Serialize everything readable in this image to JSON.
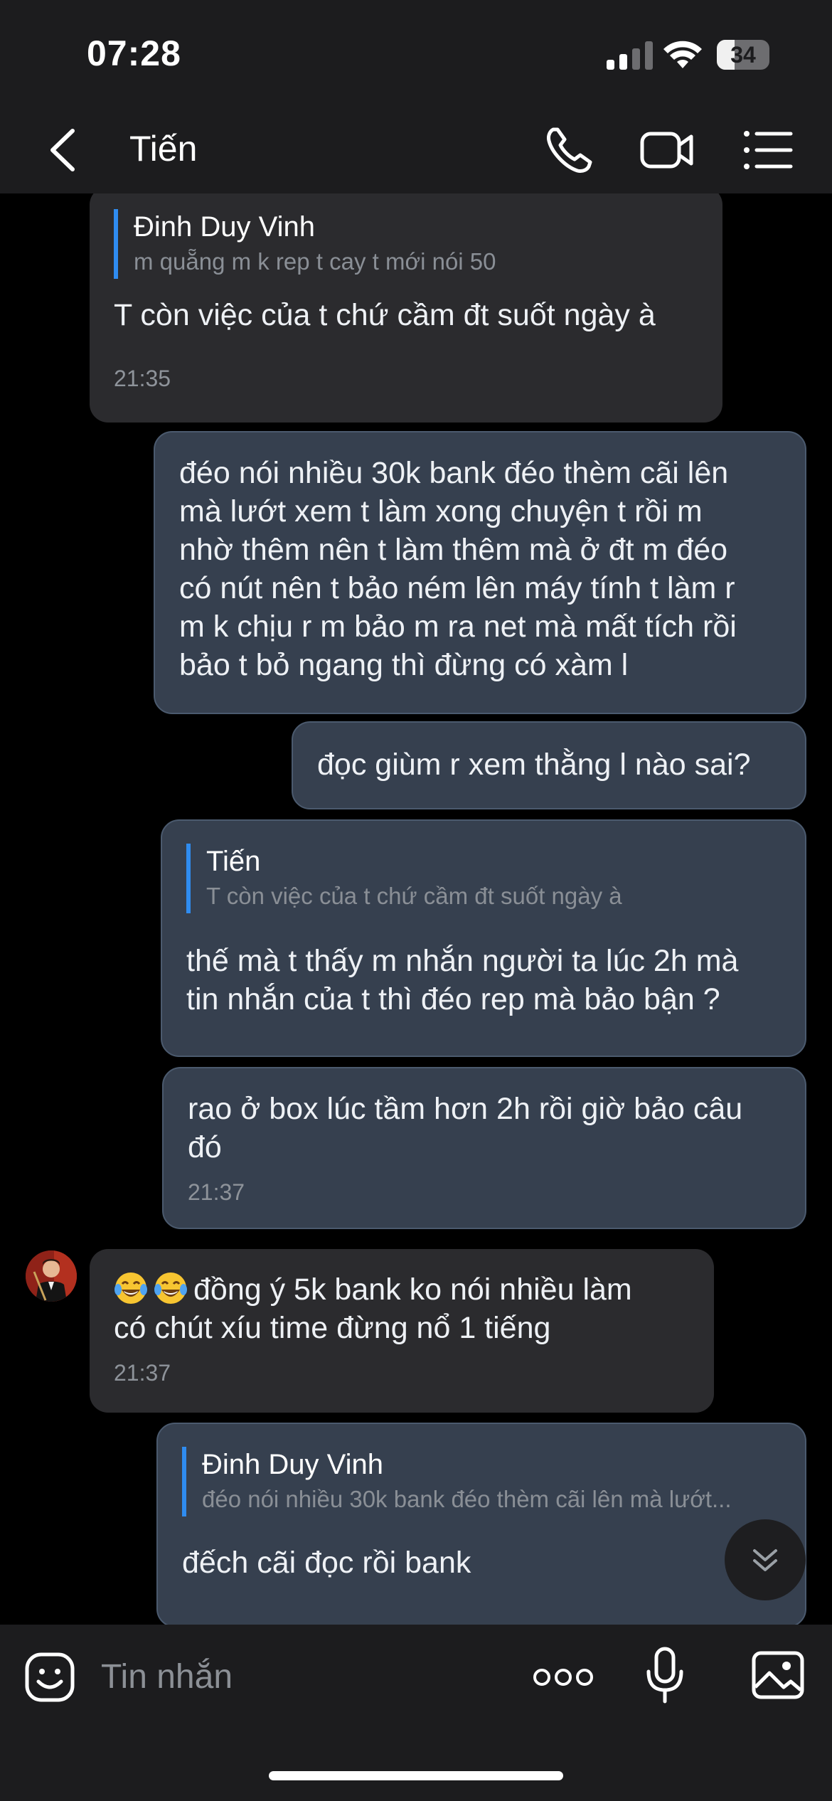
{
  "status_bar": {
    "time": "07:28",
    "battery": "34",
    "battery_level": 0.34
  },
  "header": {
    "title": "Tiến",
    "back_icon": "chevron-left-icon",
    "call_icon": "phone-icon",
    "video_icon": "video-camera-icon",
    "menu_icon": "list-icon"
  },
  "messages": [
    {
      "type": "received",
      "quote_name": "Đinh Duy Vinh",
      "quote_text": "m quẵng m k rep t cay t mới nói 50",
      "lines": [
        "T còn việc của t chứ cầm đt suốt ngày à"
      ],
      "time": "21:35"
    },
    {
      "type": "sent",
      "lines": [
        "đéo nói nhiều 30k bank đéo thèm cãi lên",
        "mà lướt xem t làm xong chuyện t rồi m",
        "nhờ thêm nên t làm thêm mà ở đt m đéo",
        "có nút nên t bảo ném lên máy tính t làm r",
        "m k chịu r m bảo m ra net mà mất tích rồi",
        "bảo t bỏ ngang thì đừng có xàm l"
      ]
    },
    {
      "type": "sent",
      "lines": [
        "đọc giùm r xem thằng l nào sai?"
      ]
    },
    {
      "type": "sent",
      "quote_name": "Tiến",
      "quote_text": "T còn việc của t chứ cầm đt suốt ngày à",
      "lines": [
        "thế mà t thấy m nhắn người ta lúc 2h mà",
        "tin nhắn của t thì đéo rep mà bảo bận ?"
      ]
    },
    {
      "type": "sent",
      "lines": [
        "rao ở box lúc tầm hơn 2h rồi giờ bảo câu",
        "đó"
      ],
      "time": "21:37"
    },
    {
      "type": "received",
      "emoji": "😂",
      "lines": [
        "đồng ý 5k bank ko nói nhiều làm",
        "có chút xíu time đừng nổ 1 tiếng"
      ],
      "time": "21:37"
    },
    {
      "type": "sent",
      "quote_name": "Đinh Duy Vinh",
      "quote_text": "đéo nói nhiều 30k bank đéo thèm cãi lên mà lướt...",
      "lines": [
        "đếch cãi đọc rồi bank"
      ]
    }
  ],
  "input": {
    "placeholder": "Tin nhắn",
    "sticker_icon": "sticker-face-icon",
    "more_icon": "more-dots-icon",
    "mic_icon": "microphone-icon",
    "photo_icon": "photo-icon"
  },
  "scroll_icon": "double-chevron-down-icon",
  "colors": {
    "sent_bubble": "#36404f",
    "received_bubble": "#2b2b2e",
    "quote_bar": "#2f8cf0",
    "header": "#1c1c1e"
  }
}
